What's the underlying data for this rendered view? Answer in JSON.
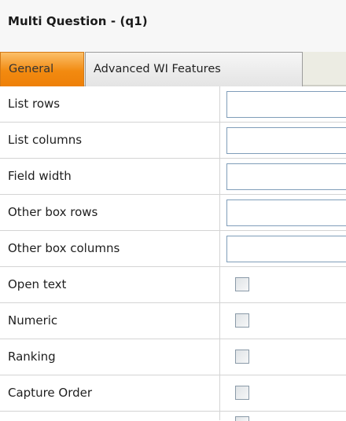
{
  "panel": {
    "title": "Multi Question - (q1)"
  },
  "tabs": [
    {
      "label": "General",
      "active": true
    },
    {
      "label": "Advanced WI Features",
      "active": false
    }
  ],
  "fields": [
    {
      "label": "List rows",
      "type": "text",
      "value": ""
    },
    {
      "label": "List columns",
      "type": "text",
      "value": ""
    },
    {
      "label": "Field width",
      "type": "text",
      "value": ""
    },
    {
      "label": "Other box rows",
      "type": "text",
      "value": ""
    },
    {
      "label": "Other box columns",
      "type": "text",
      "value": ""
    },
    {
      "label": "Open text",
      "type": "checkbox",
      "checked": false
    },
    {
      "label": "Numeric",
      "type": "checkbox",
      "checked": false
    },
    {
      "label": "Ranking",
      "type": "checkbox",
      "checked": false
    },
    {
      "label": "Capture Order",
      "type": "checkbox",
      "checked": false
    }
  ],
  "colors": {
    "active_tab": "#f28a10",
    "input_border": "#7f9db9",
    "tabstrip_bg": "#ecece3"
  }
}
